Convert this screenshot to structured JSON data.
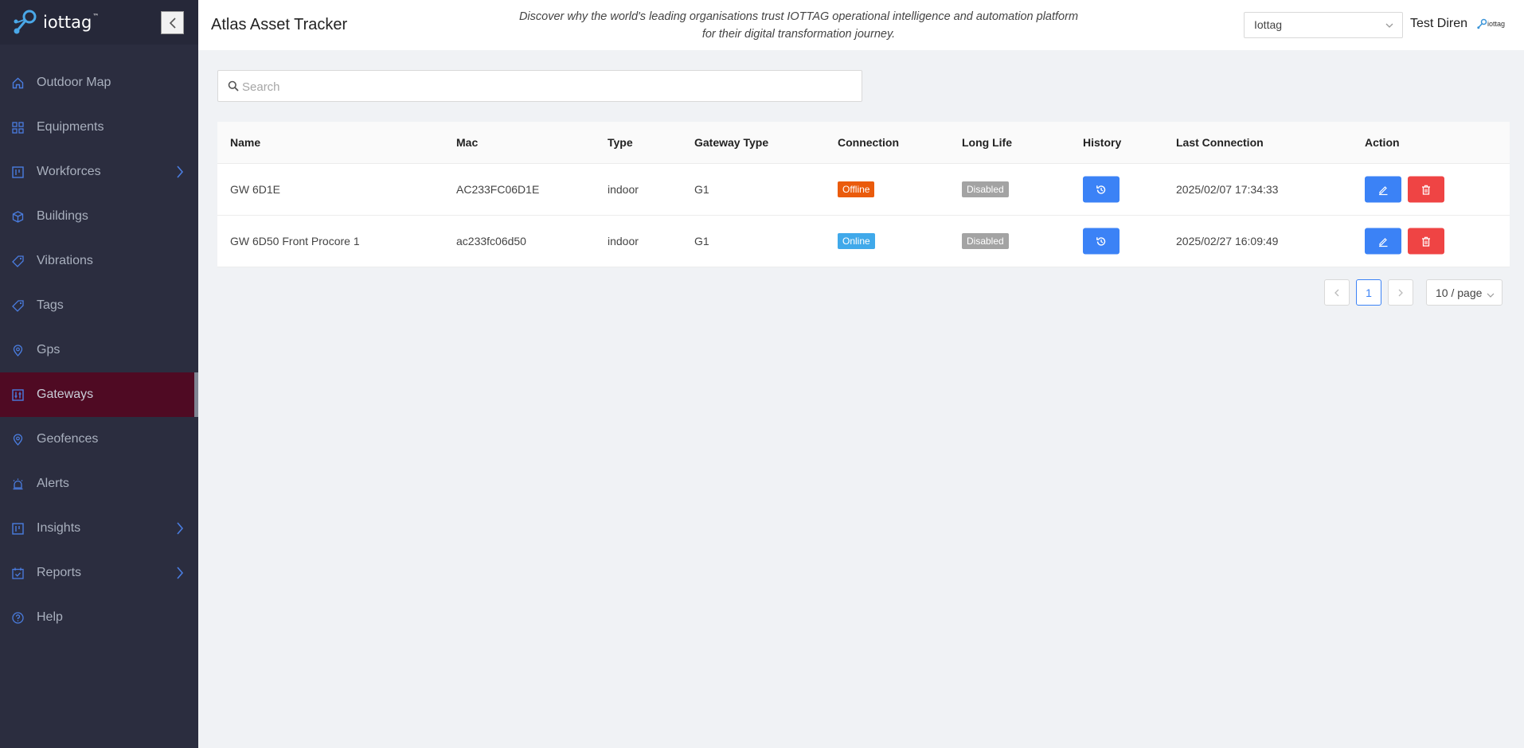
{
  "brand": {
    "name": "iottag",
    "tm": "™"
  },
  "sidebar": {
    "items": [
      {
        "label": "Outdoor Map",
        "icon": "home-icon"
      },
      {
        "label": "Equipments",
        "icon": "grid-icon"
      },
      {
        "label": "Workforces",
        "icon": "board-icon",
        "expandable": true
      },
      {
        "label": "Buildings",
        "icon": "cube-icon"
      },
      {
        "label": "Vibrations",
        "icon": "tag-icon"
      },
      {
        "label": "Tags",
        "icon": "tag-icon"
      },
      {
        "label": "Gps",
        "icon": "location-pin-icon"
      },
      {
        "label": "Gateways",
        "icon": "gateway-icon",
        "active": true
      },
      {
        "label": "Geofences",
        "icon": "location-pin-icon"
      },
      {
        "label": "Alerts",
        "icon": "alarm-icon"
      },
      {
        "label": "Insights",
        "icon": "board-icon",
        "expandable": true
      },
      {
        "label": "Reports",
        "icon": "calendar-check-icon",
        "expandable": true
      },
      {
        "label": "Help",
        "icon": "help-circle-icon"
      }
    ]
  },
  "header": {
    "title": "Atlas Asset Tracker",
    "tagline": "Discover why the world's leading organisations trust IOTTAG operational intelligence and automation platform for their digital transformation journey.",
    "org_select": "Iottag",
    "user_name": "Test Diren",
    "mini_logo_text": "iottag"
  },
  "search": {
    "placeholder": "Search",
    "value": ""
  },
  "table": {
    "columns": [
      "Name",
      "Mac",
      "Type",
      "Gateway Type",
      "Connection",
      "Long Life",
      "History",
      "Last Connection",
      "Action"
    ],
    "rows": [
      {
        "name": "GW 6D1E",
        "mac": "AC233FC06D1E",
        "type": "indoor",
        "gateway_type": "G1",
        "connection": "Offline",
        "long_life": "Disabled",
        "last_connection": "2025/02/07 17:34:33"
      },
      {
        "name": "GW 6D50 Front Procore 1",
        "mac": "ac233fc06d50",
        "type": "indoor",
        "gateway_type": "G1",
        "connection": "Online",
        "long_life": "Disabled",
        "last_connection": "2025/02/27 16:09:49"
      }
    ]
  },
  "pagination": {
    "current_page": "1",
    "page_size": "10 / page"
  },
  "colors": {
    "sidebar_bg": "#2b2d3f",
    "active_bg": "#4f0a23",
    "accent": "#3b82f6",
    "danger": "#ef4444",
    "offline": "#ea5b0c",
    "online": "#40a9ea"
  }
}
